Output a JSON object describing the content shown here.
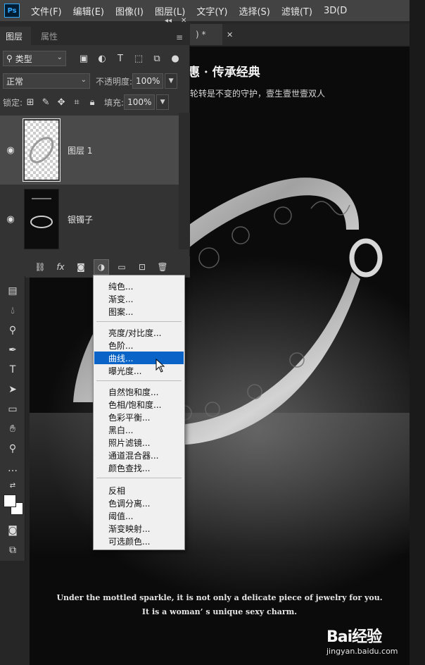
{
  "app": {
    "logo": "Ps"
  },
  "menubar": [
    "文件(F)",
    "编辑(E)",
    "图像(I)",
    "图层(L)",
    "文字(Y)",
    "选择(S)",
    "滤镜(T)",
    "3D(D"
  ],
  "document_tab": {
    "label": ") *",
    "close": "✕"
  },
  "panel": {
    "tabs": [
      "图层",
      "属性"
    ],
    "filter_select": "类型",
    "blend_mode": "正常",
    "opacity_label": "不透明度:",
    "opacity_value": "100%",
    "lock_label": "锁定:",
    "fill_label": "填充:",
    "fill_value": "100%",
    "layers": [
      {
        "name": "图层 1",
        "selected": true
      },
      {
        "name": "银镯子",
        "selected": false
      }
    ]
  },
  "adjustment_menu": {
    "group1": [
      "纯色...",
      "渐变...",
      "图案..."
    ],
    "group2": [
      "亮度/对比度...",
      "色阶...",
      "曲线...",
      "曝光度..."
    ],
    "group3": [
      "自然饱和度...",
      "色相/饱和度...",
      "色彩平衡...",
      "黑白...",
      "照片滤镜...",
      "通道混合器...",
      "颜色查找..."
    ],
    "group4": [
      "反相",
      "色调分离...",
      "阈值...",
      "渐变映射...",
      "可选颜色..."
    ],
    "highlighted": "曲线..."
  },
  "canvas": {
    "heading": "惠 · 传承经典",
    "subheading": "轮转是不变的守护，壹生壹世壹双人",
    "english_line1": "Under the mottled sparkle, it is not only a delicate piece of jewelry for you.",
    "english_line2": "It is a woman’ s unique sexy charm."
  },
  "watermark": {
    "text": "Bai经验",
    "sub": "jingyan.baidu.com"
  },
  "colors": {
    "highlight": "#0a64c8",
    "panel": "#333333",
    "menubar": "#434343"
  }
}
